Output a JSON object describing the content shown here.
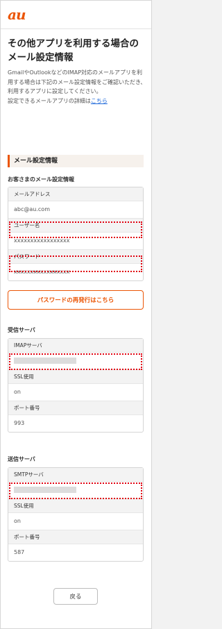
{
  "header": {
    "logo": "au"
  },
  "title": "その他アプリを利用する場合のメール設定情報",
  "description": {
    "text": "GmailやOutlookなどのIMAP対応のメールアプリを利用する場合は下記のメール設定情報をご確認いただき、利用するアプリに設定してください。",
    "detail_prefix": "設定できるメールアプリの詳細は",
    "detail_link": "こちら"
  },
  "mail_settings": {
    "heading": "メール設定情報",
    "subheading": "お客さまのメール設定情報",
    "rows": [
      {
        "label": "メールアドレス",
        "value": "abc@au.com"
      },
      {
        "label": "ユーザー名",
        "value": "xxxxxxxxxxxxxxxxx"
      },
      {
        "label": "パスワード",
        "value": "xxxxxxxxxxxxxxxxx"
      }
    ],
    "reset_button": "パスワードの再発行はこちら"
  },
  "incoming": {
    "heading": "受信サーバ",
    "rows": [
      {
        "label": "IMAPサーバ",
        "value": ""
      },
      {
        "label": "SSL使用",
        "value": "on"
      },
      {
        "label": "ポート番号",
        "value": "993"
      }
    ]
  },
  "outgoing": {
    "heading": "送信サーバ",
    "rows": [
      {
        "label": "SMTPサーバ",
        "value": ""
      },
      {
        "label": "SSL使用",
        "value": "on"
      },
      {
        "label": "ポート番号",
        "value": "587"
      }
    ]
  },
  "back_button": "戻る",
  "colors": {
    "accent": "#eb5505",
    "redact": "#e0000f",
    "link": "#1a66d9"
  }
}
